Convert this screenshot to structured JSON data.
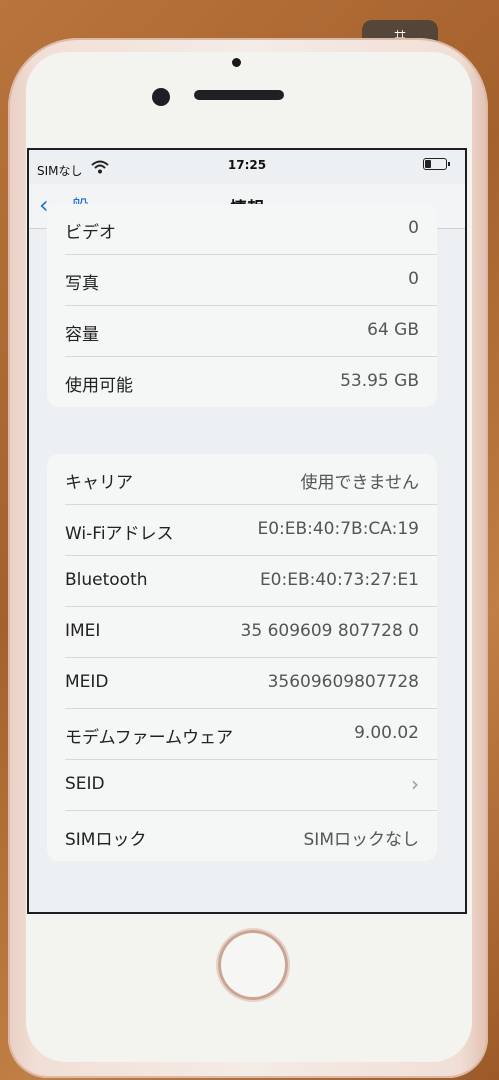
{
  "status": {
    "carrier": "SIMなし",
    "time": "17:25"
  },
  "nav": {
    "back_label": "一般",
    "title": "情報"
  },
  "group1": [
    {
      "label": "ビデオ",
      "value": "0"
    },
    {
      "label": "写真",
      "value": "0"
    },
    {
      "label": "容量",
      "value": "64 GB"
    },
    {
      "label": "使用可能",
      "value": "53.95 GB"
    }
  ],
  "group2": [
    {
      "label": "キャリア",
      "value": "使用できません"
    },
    {
      "label": "Wi-Fiアドレス",
      "value": "E0:EB:40:7B:CA:19"
    },
    {
      "label": "Bluetooth",
      "value": "E0:EB:40:73:27:E1"
    },
    {
      "label": "IMEI",
      "value": "35 609609 807728 0"
    },
    {
      "label": "MEID",
      "value": "35609609807728"
    },
    {
      "label": "モデムファームウェア",
      "value": "9.00.02"
    },
    {
      "label": "SEID",
      "value": ""
    },
    {
      "label": "SIMロック",
      "value": "SIMロックなし"
    }
  ]
}
